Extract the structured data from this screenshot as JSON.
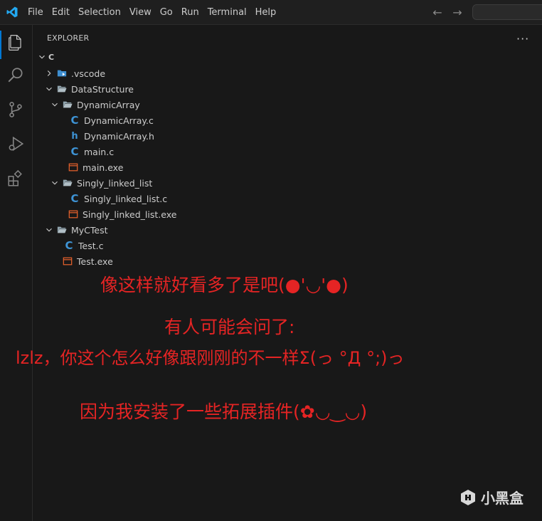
{
  "menu": [
    "File",
    "Edit",
    "Selection",
    "View",
    "Go",
    "Run",
    "Terminal",
    "Help"
  ],
  "nav": {
    "back_icon": "arrow-left-icon",
    "forward_icon": "arrow-right-icon"
  },
  "activity": [
    "explorer-icon",
    "search-icon",
    "source-control-icon",
    "run-debug-icon",
    "extensions-icon"
  ],
  "explorer": {
    "header": "EXPLORER",
    "more": "···",
    "root": "C",
    "items": [
      {
        "label": ".vscode"
      },
      {
        "label": "DataStructure"
      },
      {
        "label": "DynamicArray"
      },
      {
        "label": "DynamicArray.c"
      },
      {
        "label": "DynamicArray.h"
      },
      {
        "label": "main.c"
      },
      {
        "label": "main.exe"
      },
      {
        "label": "Singly_linked_list"
      },
      {
        "label": "Singly_linked_list.c"
      },
      {
        "label": "Singly_linked_list.exe"
      },
      {
        "label": "MyCTest"
      },
      {
        "label": "Test.c"
      },
      {
        "label": "Test.exe"
      }
    ]
  },
  "overlay": {
    "line1": "像这样就好看多了是吧(●'◡'●)",
    "line2": "有人可能会问了:",
    "line3": "lzlz，你这个怎么好像跟刚刚的不一样Σ(っ °Д °;)っ",
    "line4": "因为我安装了一些拓展插件(✿◡‿◡)"
  },
  "watermark": "小黑盒",
  "colors": {
    "accent": "#0078d4",
    "overlay_text": "#e52424",
    "c_icon": "#3e94d6",
    "exe_icon": "#e8622c"
  }
}
